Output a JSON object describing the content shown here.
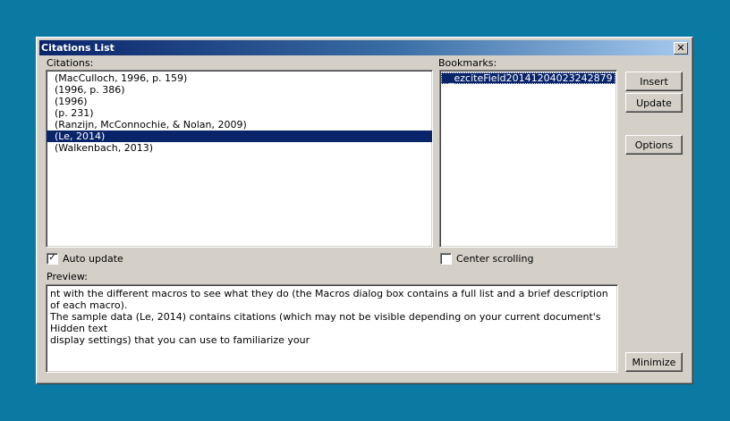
{
  "window": {
    "title": "Citations List",
    "close_glyph": "✕"
  },
  "citations": {
    "label": "Citations:",
    "items": [
      {
        "text": "(MacCulloch, 1996, p. 159)",
        "selected": false
      },
      {
        "text": "(1996, p. 386)",
        "selected": false
      },
      {
        "text": "(1996)",
        "selected": false
      },
      {
        "text": "(p. 231)",
        "selected": false
      },
      {
        "text": "(Ranzijn, McConnochie, & Nolan, 2009)",
        "selected": false
      },
      {
        "text": "(Le, 2014)",
        "selected": true
      },
      {
        "text": "(Walkenbach, 2013)",
        "selected": false
      }
    ]
  },
  "bookmarks": {
    "label": "Bookmarks:",
    "items": [
      "_ezciteField20141204023242879"
    ]
  },
  "buttons": {
    "insert": "Insert",
    "update": "Update",
    "options": "Options",
    "minimize": "Minimize"
  },
  "checkboxes": {
    "auto_update": {
      "label": "Auto update",
      "checked": true,
      "mark": "✓"
    },
    "center_scrolling": {
      "label": "Center scrolling",
      "checked": false,
      "mark": ""
    }
  },
  "preview": {
    "label": "Preview:",
    "text": "nt with the different macros to see what they do (the Macros dialog box contains a full list and a brief description of each macro).\nThe sample data (Le, 2014) contains citations (which may not be visible depending on your current document's Hidden text\ndisplay settings) that you can use to familiarize your"
  },
  "colors": {
    "desktop": "#0a7aa3",
    "dialog_face": "#d4d0c8",
    "selection": "#0a246a",
    "titlebar_start": "#0a246a"
  }
}
